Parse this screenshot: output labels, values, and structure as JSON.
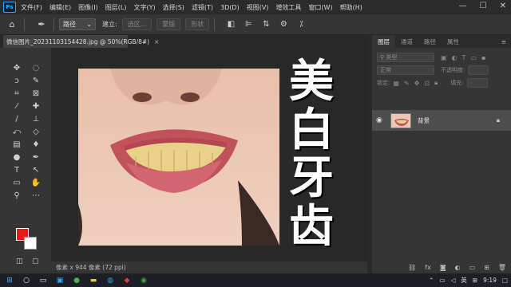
{
  "app": {
    "logo": "Ps"
  },
  "menu": [
    "文件(F)",
    "编辑(E)",
    "图像(I)",
    "图层(L)",
    "文字(Y)",
    "选择(S)",
    "滤镜(T)",
    "3D(D)",
    "视图(V)",
    "增效工具",
    "窗口(W)",
    "帮助(H)"
  ],
  "window_controls": {
    "minimize": "—",
    "maximize": "☐",
    "close": "✕"
  },
  "options": {
    "tool_mode": "路径",
    "build_label": "建立:",
    "selection_btn": "选区...",
    "mask_btn": "蒙版",
    "shape_btn": "形状"
  },
  "document": {
    "tab_title": "微信图片_20231103154428.jpg @ 50%(RGB/8#)",
    "tab_close": "×",
    "status": "像素 x 944 像素 (72 ppi)"
  },
  "overlay_text": [
    "美",
    "白",
    "牙",
    "齿"
  ],
  "layers_panel": {
    "tabs": [
      "图层",
      "通道",
      "路径",
      "属性"
    ],
    "search_placeholder": "类型",
    "blend_mode": "正常",
    "opacity_label": "不透明度:",
    "lock_label": "锁定:",
    "fill_label": "填充:",
    "layer_name": "背景"
  },
  "taskbar": {
    "time": "9:19",
    "ime": "英"
  },
  "colors": {
    "foreground": "#e81b1b",
    "background": "#ffffff",
    "accent": "#31a8ff"
  }
}
